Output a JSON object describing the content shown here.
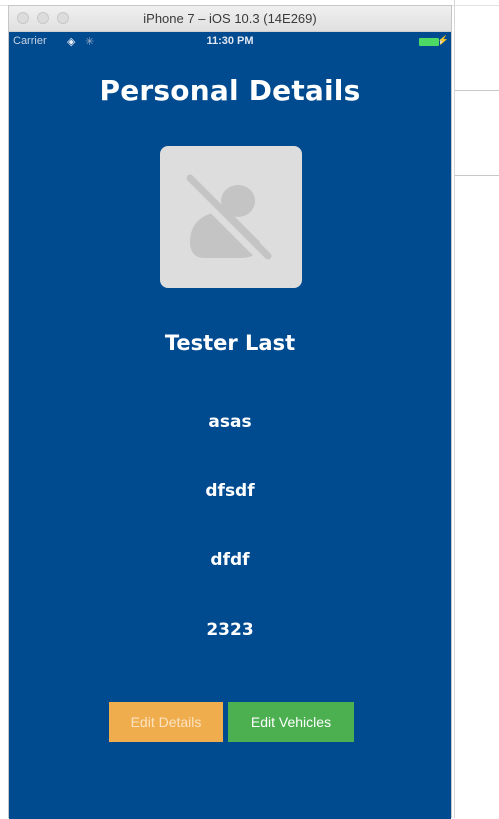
{
  "window": {
    "title": "iPhone 7 – iOS 10.3 (14E269)"
  },
  "status_bar": {
    "carrier": "Carrier",
    "time": "11:30 PM",
    "wifi_icon": "wifi-icon",
    "activity_icon": "activity-spinner-icon",
    "battery_icon": "battery-icon",
    "battery_color": "#4cd964"
  },
  "page": {
    "title": "Personal Details",
    "background_color": "#004a8f"
  },
  "avatar": {
    "icon": "no-photo-person-icon"
  },
  "details": {
    "name": "Tester Last",
    "field1": "asas",
    "field2": "dfsdf",
    "field3": "dfdf",
    "field4": "2323"
  },
  "buttons": {
    "edit_details": "Edit Details",
    "edit_details_color": "#f0ad4e",
    "edit_vehicles": "Edit Vehicles",
    "edit_vehicles_color": "#4caf50"
  }
}
